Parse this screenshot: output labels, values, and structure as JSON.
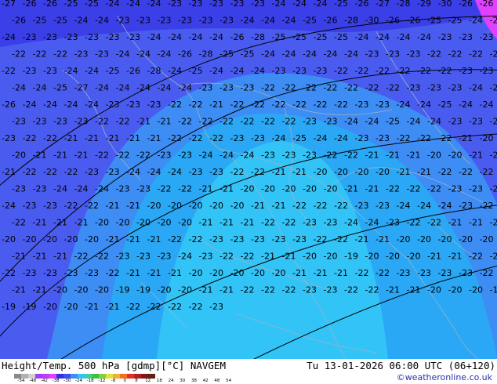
{
  "map": {
    "title": "Height/Temp. 500 hPa [gdmp][°C] NAVGEM",
    "valid_time": "Tu 13-01-2026 06:00 UTC (06+120)",
    "copyright": "©weatheronline.co.uk",
    "colors": {
      "deep_blue": "#3b3fe8",
      "blue": "#4a5cf0",
      "mid_blue": "#3d8df5",
      "light_blue": "#2aa8f5",
      "cyan": "#33c4f7",
      "magenta_corner": "#e040ff",
      "contour": "#000000",
      "border": "#9ab0c8"
    },
    "colorbar": {
      "labels": [
        "-54",
        "-48",
        "-42",
        "-38",
        "-30",
        "-24",
        "-18",
        "-12",
        "-8",
        "0",
        "8",
        "12",
        "18",
        "24",
        "30",
        "38",
        "42",
        "48",
        "54"
      ],
      "colors": [
        "#8a8a8a",
        "#b0b0b0",
        "#d0d0d0",
        "#9e3cff",
        "#c23cff",
        "#e040ff",
        "#3030e0",
        "#4050f0",
        "#3d8df5",
        "#33c4f7",
        "#3fd0a0",
        "#40c040",
        "#80d040",
        "#e0e040",
        "#f0b030",
        "#f07020",
        "#e03020",
        "#b02020",
        "#801818",
        "#602010"
      ]
    },
    "temperature_labels": [
      "-27",
      "-26",
      "-26",
      "-25",
      "-25",
      "-24",
      "-24",
      "-24",
      "-23",
      "-23",
      "-23",
      "-23",
      "-23",
      "-24",
      "-24",
      "-24",
      "-25",
      "-26",
      "-27",
      "-28",
      "-29",
      "-30",
      "-26",
      "-26",
      "-26",
      "-25",
      "-25",
      "-24",
      "-24",
      "-23",
      "-23",
      "-23",
      "-23",
      "-23",
      "-23",
      "-24",
      "-24",
      "-24",
      "-25",
      "-26",
      "-28",
      "-30",
      "-26",
      "-26",
      "-25",
      "-25",
      "-24",
      "-24",
      "-24",
      "-23",
      "-23",
      "-23",
      "-23",
      "-23",
      "-23",
      "-24",
      "-24",
      "-24",
      "-24",
      "-26",
      "-28",
      "-25",
      "-25",
      "-25",
      "-25",
      "-24",
      "-24",
      "-24",
      "-24",
      "-23",
      "-23",
      "-23",
      "-22",
      "-22",
      "-22",
      "-23",
      "-23",
      "-24",
      "-24",
      "-24",
      "-26",
      "-28",
      "-25",
      "-25",
      "-24",
      "-24",
      "-24",
      "-24",
      "-24",
      "-23",
      "-23",
      "-23",
      "-22",
      "-22",
      "-22",
      "-22",
      "-22",
      "-23",
      "-23",
      "-24",
      "-24",
      "-25",
      "-26",
      "-28",
      "-24",
      "-25",
      "-24",
      "-24",
      "-24",
      "-23",
      "-23",
      "-23",
      "-22",
      "-22",
      "-22",
      "-22",
      "-22",
      "-22",
      "-23",
      "-23",
      "-24",
      "-24",
      "-25",
      "-27",
      "-24",
      "-24",
      "-24",
      "-24",
      "-24",
      "-23",
      "-23",
      "-23",
      "-22",
      "-22",
      "-22",
      "-22",
      "-22",
      "-22",
      "-22",
      "-23",
      "-23",
      "-23",
      "-24",
      "-25",
      "-26",
      "-24",
      "-24",
      "-24",
      "-24",
      "-23",
      "-23",
      "-23",
      "-22",
      "-22",
      "-21",
      "-22",
      "-22",
      "-22",
      "-22",
      "-22",
      "-22",
      "-23",
      "-23",
      "-24",
      "-24",
      "-25",
      "-24",
      "-24",
      "-23",
      "-23",
      "-23",
      "-23",
      "-22",
      "-22",
      "-21",
      "-21",
      "-22",
      "-22",
      "-22",
      "-22",
      "-22",
      "-22",
      "-23",
      "-23",
      "-24",
      "-24",
      "-25",
      "-24",
      "-24",
      "-23",
      "-23",
      "-23",
      "-23",
      "-22",
      "-22",
      "-21",
      "-21",
      "-21",
      "-21",
      "-21",
      "-22",
      "-22",
      "-22",
      "-23",
      "-23",
      "-24",
      "-25",
      "-24",
      "-24",
      "-23",
      "-23",
      "-22",
      "-22",
      "-22",
      "-21",
      "-20",
      "-20",
      "-21",
      "-21",
      "-21",
      "-22",
      "-22",
      "-22",
      "-23",
      "-23",
      "-24",
      "-24",
      "-24",
      "-23",
      "-23",
      "-23",
      "-22",
      "-22",
      "-21",
      "-21",
      "-21",
      "-20",
      "-20",
      "-21",
      "-21",
      "-21",
      "-22",
      "-22",
      "-22",
      "-23",
      "-23",
      "-24",
      "-24",
      "-24",
      "-23",
      "-23",
      "-22",
      "-22",
      "-21",
      "-21",
      "-20",
      "-20",
      "-20",
      "-20",
      "-21",
      "-21",
      "-22",
      "-22",
      "-22",
      "-23",
      "-23",
      "-24",
      "-24",
      "-24",
      "-23",
      "-23",
      "-22",
      "-22",
      "-21",
      "-21",
      "-20",
      "-20",
      "-20",
      "-20",
      "-20",
      "-21",
      "-21",
      "-22",
      "-22",
      "-22",
      "-23",
      "-23",
      "-24",
      "-24",
      "-23",
      "-23",
      "-22",
      "-22",
      "-21",
      "-21",
      "-20",
      "-20",
      "-20",
      "-20",
      "-20",
      "-21",
      "-21",
      "-22",
      "-22",
      "-22",
      "-23",
      "-23",
      "-24",
      "-24",
      "-24",
      "-23",
      "-22",
      "-22",
      "-21",
      "-21",
      "-21",
      "-20",
      "-20",
      "-20",
      "-20",
      "-20",
      "-21",
      "-21",
      "-21",
      "-22",
      "-22",
      "-23",
      "-23",
      "-24",
      "-24",
      "-23",
      "-22",
      "-22",
      "-21",
      "-21",
      "-20",
      "-20",
      "-20",
      "-20",
      "-20",
      "-20",
      "-21",
      "-21",
      "-21",
      "-22",
      "-22",
      "-23",
      "-23",
      "-23",
      "-23",
      "-23",
      "-22",
      "-22",
      "-21",
      "-21",
      "-20",
      "-20",
      "-20",
      "-20",
      "-20",
      "-21",
      "-21",
      "-21",
      "-22",
      "-22",
      "-23",
      "-23",
      "-23",
      "-24",
      "-23",
      "-22",
      "-22",
      "-21",
      "-21",
      "-20",
      "-20",
      "-19",
      "-20",
      "-20",
      "-20",
      "-21",
      "-21",
      "-22",
      "-22",
      "-22",
      "-23",
      "-23",
      "-23",
      "-23",
      "-22",
      "-21",
      "-21",
      "-21",
      "-20",
      "-20",
      "-20",
      "-20",
      "-20",
      "-21",
      "-21",
      "-21",
      "-22",
      "-22",
      "-23",
      "-23",
      "-23",
      "-23",
      "-22",
      "-21",
      "-21",
      "-20",
      "-20",
      "-20",
      "-19",
      "-19",
      "-20",
      "-20",
      "-21",
      "-21",
      "-22",
      "-22",
      "-22",
      "-23",
      "-23",
      "-22",
      "-22",
      "-21",
      "-21",
      "-20",
      "-20",
      "-20",
      "-19",
      "-19",
      "-19",
      "-20",
      "-20",
      "-21",
      "-21",
      "-22",
      "-22",
      "-22",
      "-22",
      "-23"
    ]
  }
}
